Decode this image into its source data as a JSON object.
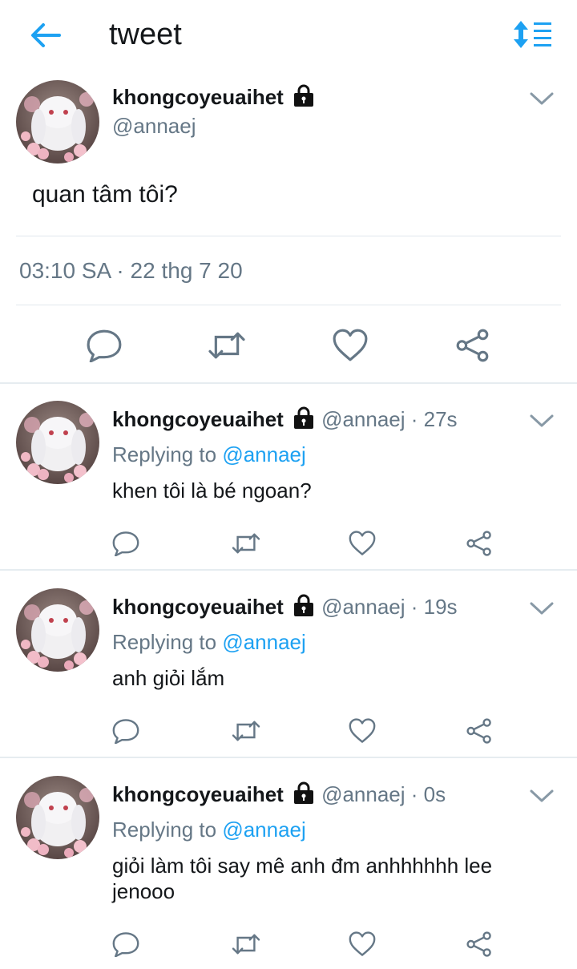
{
  "header": {
    "title": "tweet",
    "back_icon": "arrow-left-icon",
    "sort_icon": "sort-lines-icon",
    "accent": "#1da1f2"
  },
  "main_tweet": {
    "name": "khongcoyeuaihet",
    "handle": "@annaej",
    "text": "quan tâm tôi?",
    "timestamp": "03:10 SA · 22 thg 7 20"
  },
  "replies": [
    {
      "name": "khongcoyeuaihet",
      "handle_time": "@annaej · 27s",
      "replying_prefix": "Replying to ",
      "replying_to": "@annaej",
      "text": "khen tôi là bé ngoan?"
    },
    {
      "name": "khongcoyeuaihet",
      "handle_time": "@annaej · 19s",
      "replying_prefix": "Replying to ",
      "replying_to": "@annaej",
      "text": "anh giỏi lắm"
    },
    {
      "name": "khongcoyeuaihet",
      "handle_time": "@annaej · 0s",
      "replying_prefix": "Replying to ",
      "replying_to": "@annaej",
      "text": "giỏi làm tôi say mê anh đm anhhhhhh lee jenooo"
    }
  ],
  "icons": {
    "reply": "reply-icon",
    "retweet": "retweet-icon",
    "like": "heart-icon",
    "share": "share-icon",
    "lock": "lock-icon",
    "chevron": "chevron-down-icon"
  }
}
